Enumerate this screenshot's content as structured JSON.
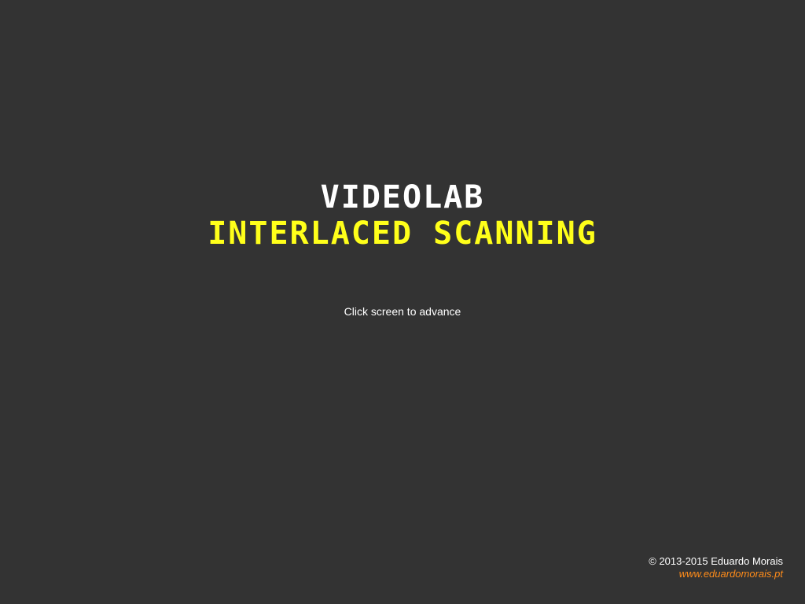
{
  "title": {
    "main": "VIDEOLAB",
    "sub": "INTERLACED SCANNING"
  },
  "hint": "Click screen to advance",
  "footer": {
    "copyright": "© 2013-2015 Eduardo Morais",
    "link": "www.eduardomorais.pt"
  },
  "colors": {
    "background": "#333333",
    "title_main": "#ffffff",
    "title_sub": "#ffff1a",
    "link": "#ff8c1a"
  }
}
